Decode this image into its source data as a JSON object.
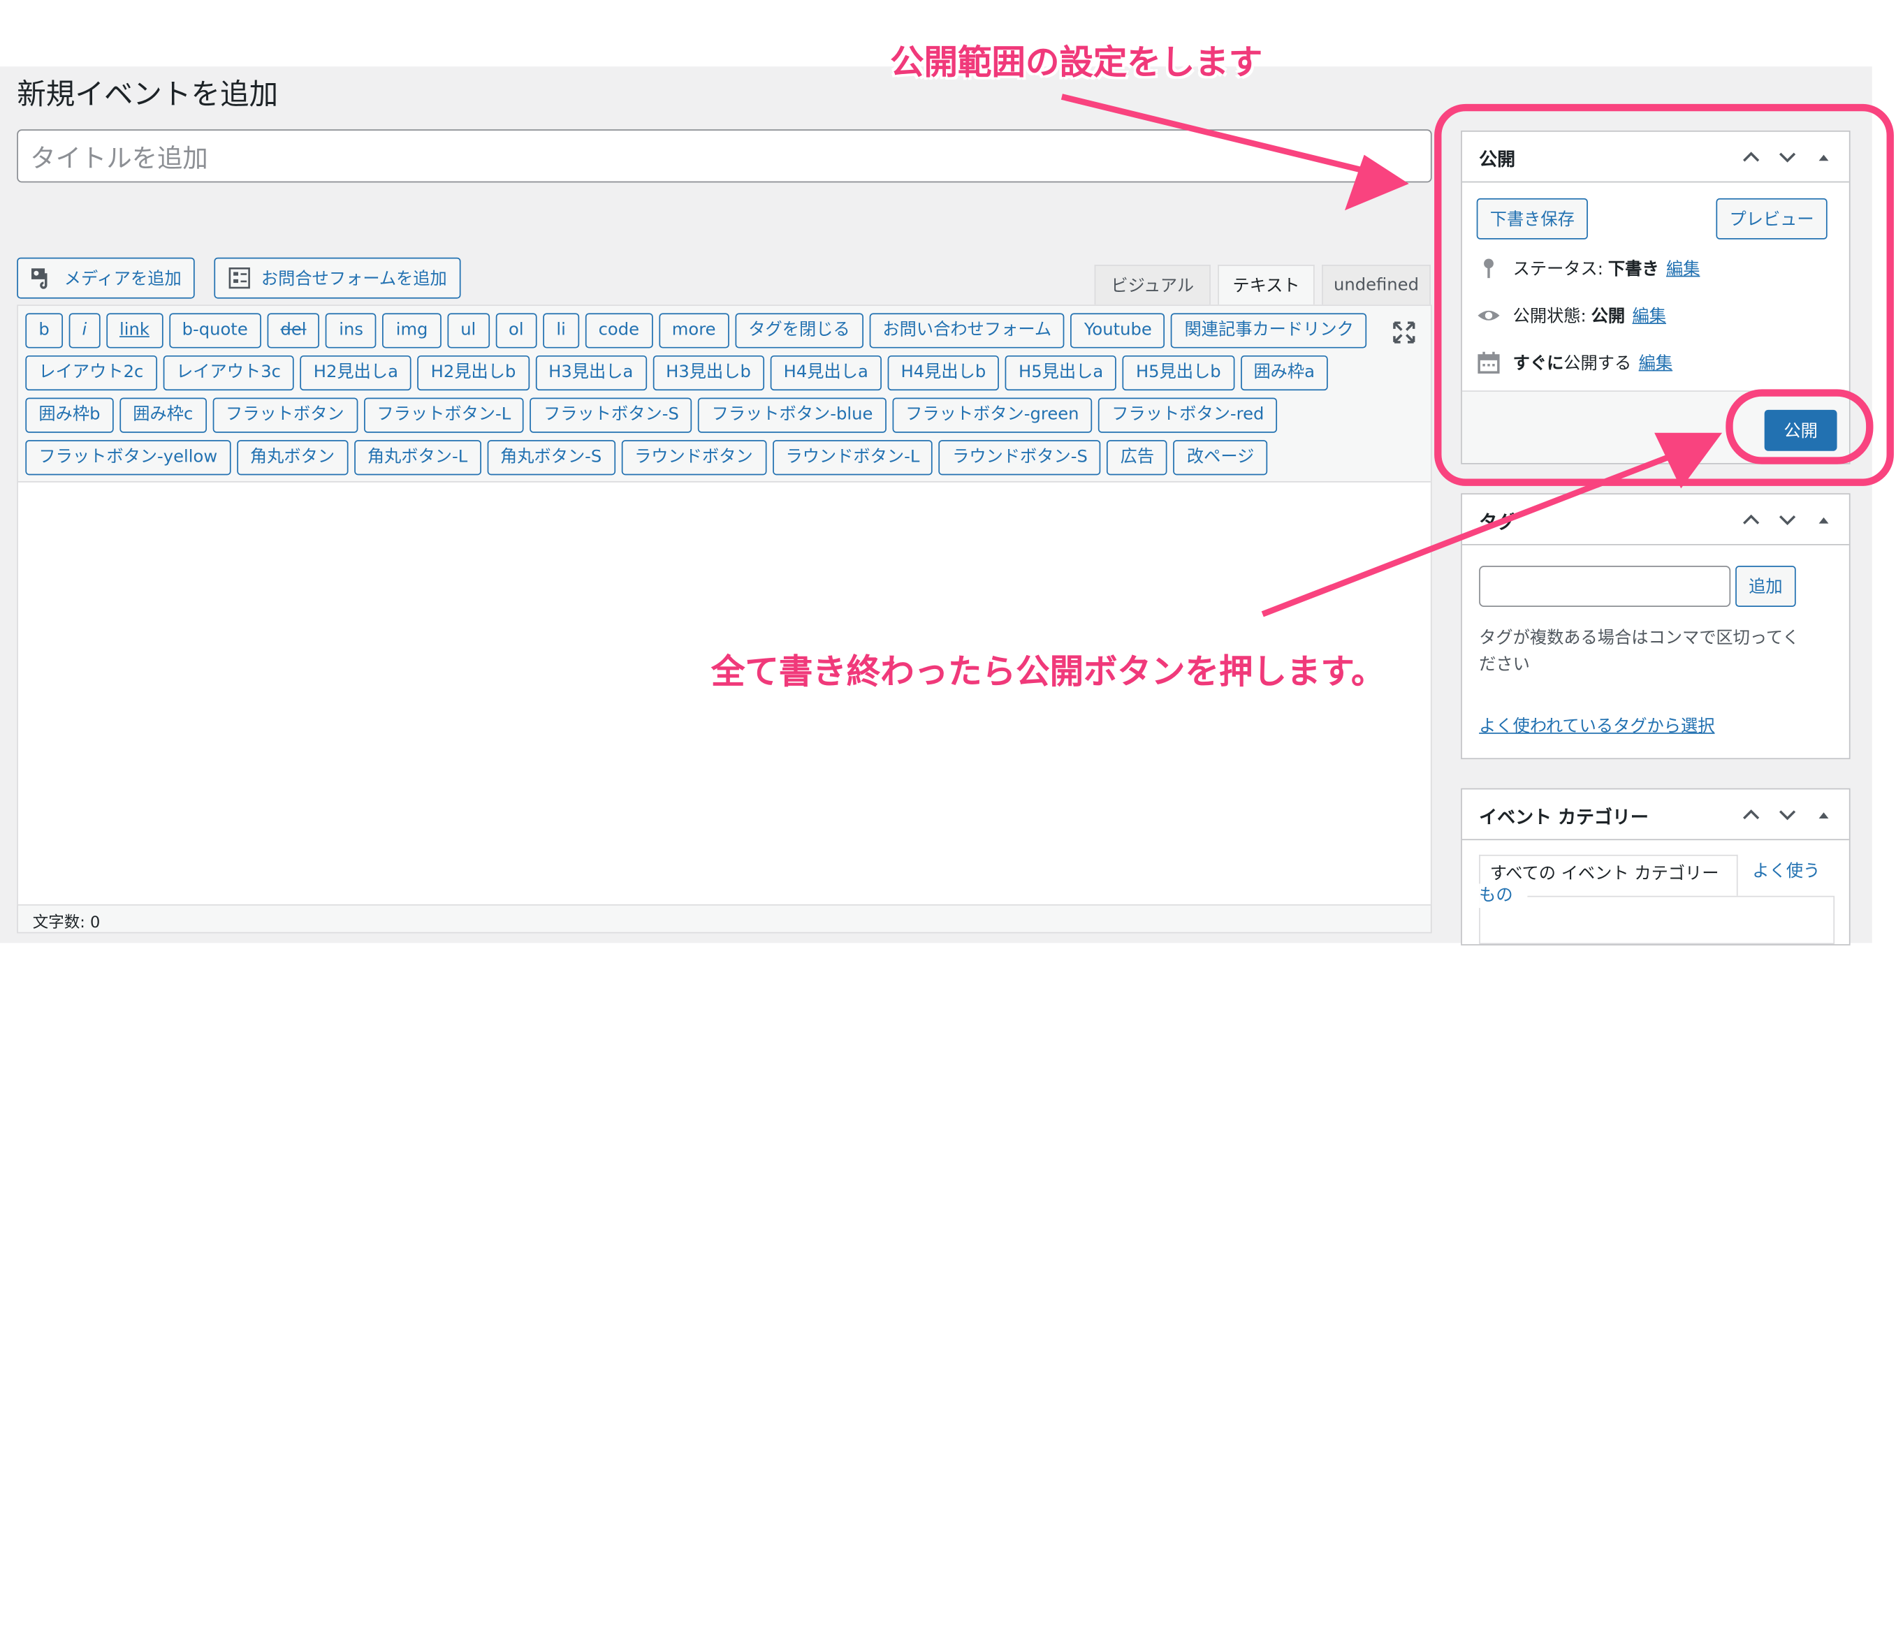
{
  "page": {
    "title": "新規イベントを追加",
    "title_placeholder": "タイトルを追加"
  },
  "media": {
    "add_media": "メディアを追加",
    "add_form": "お問合せフォームを追加"
  },
  "editor_tabs": [
    "ビジュアル",
    "テキスト",
    "undefined"
  ],
  "toolbar": {
    "row1": [
      "b",
      "i",
      "link",
      "b-quote",
      "del",
      "ins",
      "img",
      "ul",
      "ol",
      "li",
      "code",
      "more",
      "タグを閉じる",
      "お問い合わせフォーム",
      "Youtube",
      "関連記事カードリンク"
    ],
    "row2": [
      "レイアウト2c",
      "レイアウト3c",
      "H2見出しa",
      "H2見出しb",
      "H3見出しa",
      "H3見出しb",
      "H4見出しa",
      "H4見出しb",
      "H5見出しa",
      "H5見出しb",
      "囲み枠a"
    ],
    "row3": [
      "囲み枠b",
      "囲み枠c",
      "フラットボタン",
      "フラットボタン-L",
      "フラットボタン-S",
      "フラットボタン-blue",
      "フラットボタン-green",
      "フラットボタン-red"
    ],
    "row4": [
      "フラットボタン-yellow",
      "角丸ボタン",
      "角丸ボタン-L",
      "角丸ボタン-S",
      "ラウンドボタン",
      "ラウンドボタン-L",
      "ラウンドボタン-S",
      "広告",
      "改ページ"
    ]
  },
  "wordcount": "文字数: 0",
  "publish_box": {
    "title": "公開",
    "save_draft": "下書き保存",
    "preview": "プレビュー",
    "status_label": "ステータス:",
    "status_value": "下書き",
    "visibility_label": "公開状態:",
    "visibility_value": "公開",
    "schedule_value": "すぐに",
    "schedule_label": "公開する",
    "edit": "編集",
    "publish": "公開"
  },
  "tags_box": {
    "title": "タグ",
    "add": "追加",
    "help": [
      "タグが複数ある場合はコンマで区切ってく",
      "ださい"
    ],
    "choose_link": "よく使われているタグから選択"
  },
  "category_box": {
    "title": "イベント カテゴリー",
    "tab_all": "すべての イベント カテゴリー",
    "tab_popular": [
      "よく使う",
      "もの"
    ]
  },
  "annotations": {
    "top": "公開範囲の設定をします",
    "bottom": "全て書き終わったら公開ボタンを押します。"
  },
  "colors": {
    "accent": "#2271b1",
    "annotation": "#f9437f"
  }
}
